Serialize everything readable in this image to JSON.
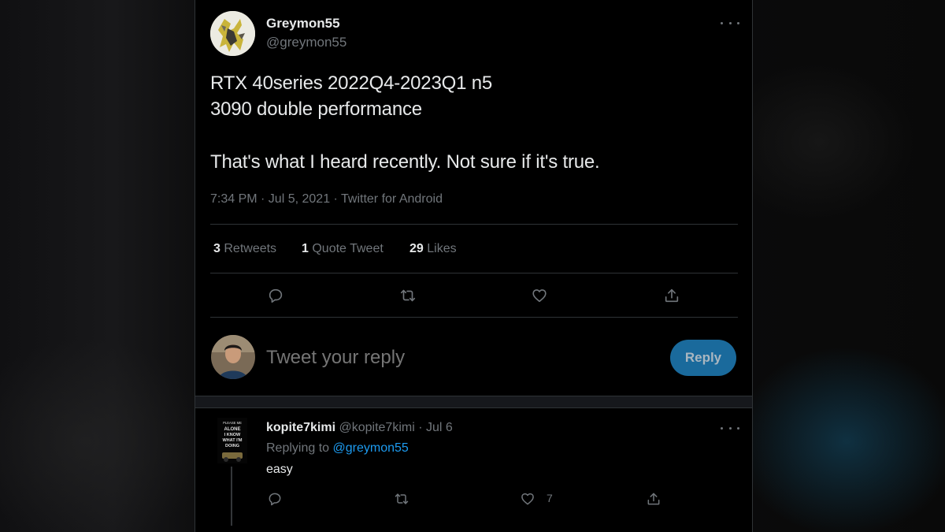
{
  "tweet": {
    "display_name": "Greymon55",
    "handle": "@greymon55",
    "text_line1": "RTX 40series 2022Q4-2023Q1 n5",
    "text_line2": "3090 double performance",
    "text_line3": "That's what I heard recently. Not sure if it's true.",
    "meta": "7:34 PM · Jul 5, 2021 · Twitter for Android",
    "stats": {
      "retweets_count": "3",
      "retweets_label": "Retweets",
      "quotes_count": "1",
      "quotes_label": "Quote Tweet",
      "likes_count": "29",
      "likes_label": "Likes"
    },
    "actions": [
      "reply-icon",
      "retweet-icon",
      "like-icon",
      "share-icon"
    ]
  },
  "composer": {
    "placeholder": "Tweet your reply",
    "button_label": "Reply"
  },
  "reply": {
    "display_name": "kopite7kimi",
    "handle": "@kopite7kimi",
    "separator": "·",
    "date": "Jul 6",
    "replying_prefix": "Replying to",
    "replying_handle": "@greymon55",
    "text": "easy",
    "like_count": "7",
    "avatar_text": "PLEASE ME ALONE I KNOW WHAT I'M DOING"
  },
  "colors": {
    "background": "#000000",
    "text": "#e7e9ea",
    "muted": "#71767b",
    "border": "#2f3336",
    "accent": "#1d9bf0",
    "reply_button": "#1a6a9c"
  }
}
